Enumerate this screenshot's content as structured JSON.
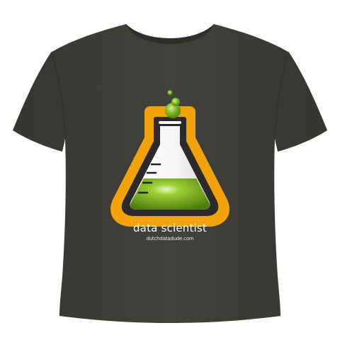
{
  "product": {
    "print_title": "data scientist",
    "print_url": "dutchdatadude.com",
    "graphic": "flask-icon"
  },
  "colors": {
    "shirt": "#3f3e39",
    "background": "#ffffff",
    "flask_outline": "#f2a20a",
    "liquid": "#7cb518",
    "text": "#ffffff"
  }
}
